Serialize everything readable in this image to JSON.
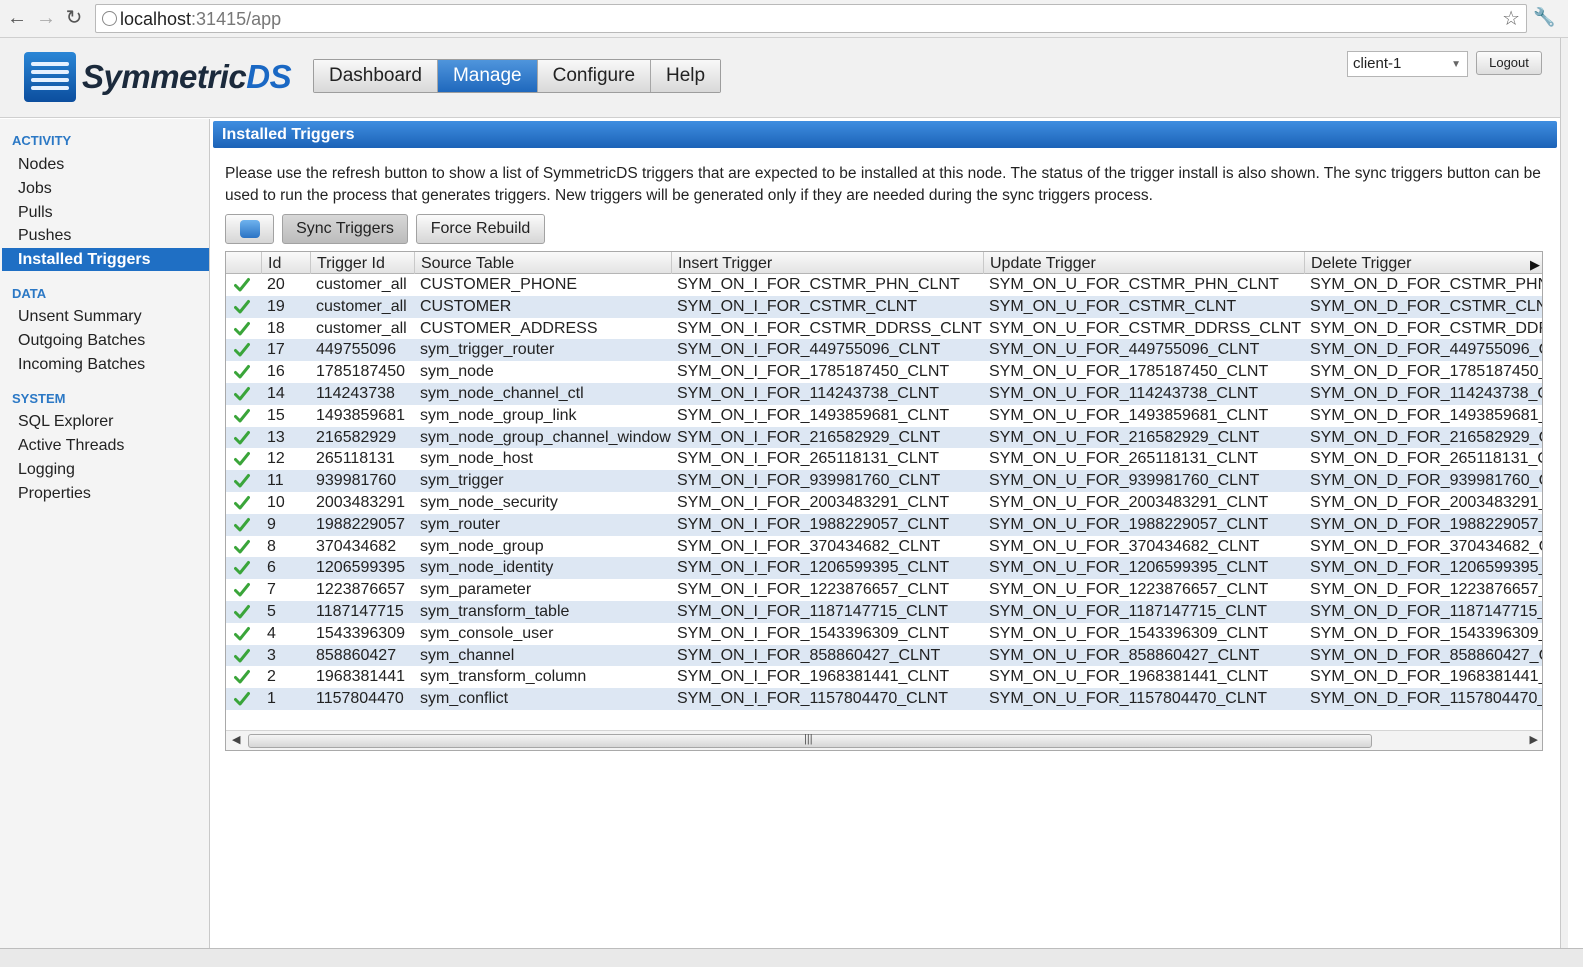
{
  "browser": {
    "url_host": "localhost",
    "url_rest": ":31415/app"
  },
  "app": {
    "logo_main": "Symmetric",
    "logo_accent": "DS",
    "tabs": [
      "Dashboard",
      "Manage",
      "Configure",
      "Help"
    ],
    "active_tab": "Manage",
    "node_select": "client-1",
    "logout_label": "Logout"
  },
  "sidebar": {
    "sections": [
      {
        "title": "ACTIVITY",
        "items": [
          "Nodes",
          "Jobs",
          "Pulls",
          "Pushes",
          "Installed Triggers"
        ]
      },
      {
        "title": "DATA",
        "items": [
          "Unsent Summary",
          "Outgoing Batches",
          "Incoming Batches"
        ]
      },
      {
        "title": "SYSTEM",
        "items": [
          "SQL Explorer",
          "Active Threads",
          "Logging",
          "Properties"
        ]
      }
    ],
    "active_item": "Installed Triggers"
  },
  "panel": {
    "title": "Installed Triggers",
    "description": "Please use the refresh button to show a list of SymmetricDS triggers that are expected to be installed at this node. The status of the trigger install is also shown. The sync triggers button can be used to run the process that generates triggers. New triggers will be generated only if they are needed during the sync triggers process.",
    "buttons": {
      "sync": "Sync Triggers",
      "rebuild": "Force Rebuild"
    }
  },
  "grid": {
    "columns": [
      "",
      "Id",
      "Trigger Id",
      "Source Table",
      "Insert Trigger",
      "Update Trigger",
      "Delete Trigger"
    ],
    "rows": [
      [
        "20",
        "customer_all",
        "CUSTOMER_PHONE",
        "SYM_ON_I_FOR_CSTMR_PHN_CLNT",
        "SYM_ON_U_FOR_CSTMR_PHN_CLNT",
        "SYM_ON_D_FOR_CSTMR_PHN_"
      ],
      [
        "19",
        "customer_all",
        "CUSTOMER",
        "SYM_ON_I_FOR_CSTMR_CLNT",
        "SYM_ON_U_FOR_CSTMR_CLNT",
        "SYM_ON_D_FOR_CSTMR_CLNT"
      ],
      [
        "18",
        "customer_all",
        "CUSTOMER_ADDRESS",
        "SYM_ON_I_FOR_CSTMR_DDRSS_CLNT",
        "SYM_ON_U_FOR_CSTMR_DDRSS_CLNT",
        "SYM_ON_D_FOR_CSTMR_DDR"
      ],
      [
        "17",
        "449755096",
        "sym_trigger_router",
        "SYM_ON_I_FOR_449755096_CLNT",
        "SYM_ON_U_FOR_449755096_CLNT",
        "SYM_ON_D_FOR_449755096_C"
      ],
      [
        "16",
        "1785187450",
        "sym_node",
        "SYM_ON_I_FOR_1785187450_CLNT",
        "SYM_ON_U_FOR_1785187450_CLNT",
        "SYM_ON_D_FOR_1785187450_"
      ],
      [
        "14",
        "114243738",
        "sym_node_channel_ctl",
        "SYM_ON_I_FOR_114243738_CLNT",
        "SYM_ON_U_FOR_114243738_CLNT",
        "SYM_ON_D_FOR_114243738_C"
      ],
      [
        "15",
        "1493859681",
        "sym_node_group_link",
        "SYM_ON_I_FOR_1493859681_CLNT",
        "SYM_ON_U_FOR_1493859681_CLNT",
        "SYM_ON_D_FOR_1493859681_"
      ],
      [
        "13",
        "216582929",
        "sym_node_group_channel_window",
        "SYM_ON_I_FOR_216582929_CLNT",
        "SYM_ON_U_FOR_216582929_CLNT",
        "SYM_ON_D_FOR_216582929_C"
      ],
      [
        "12",
        "265118131",
        "sym_node_host",
        "SYM_ON_I_FOR_265118131_CLNT",
        "SYM_ON_U_FOR_265118131_CLNT",
        "SYM_ON_D_FOR_265118131_C"
      ],
      [
        "11",
        "939981760",
        "sym_trigger",
        "SYM_ON_I_FOR_939981760_CLNT",
        "SYM_ON_U_FOR_939981760_CLNT",
        "SYM_ON_D_FOR_939981760_C"
      ],
      [
        "10",
        "2003483291",
        "sym_node_security",
        "SYM_ON_I_FOR_2003483291_CLNT",
        "SYM_ON_U_FOR_2003483291_CLNT",
        "SYM_ON_D_FOR_2003483291_"
      ],
      [
        "9",
        "1988229057",
        "sym_router",
        "SYM_ON_I_FOR_1988229057_CLNT",
        "SYM_ON_U_FOR_1988229057_CLNT",
        "SYM_ON_D_FOR_1988229057_"
      ],
      [
        "8",
        "370434682",
        "sym_node_group",
        "SYM_ON_I_FOR_370434682_CLNT",
        "SYM_ON_U_FOR_370434682_CLNT",
        "SYM_ON_D_FOR_370434682_C"
      ],
      [
        "6",
        "1206599395",
        "sym_node_identity",
        "SYM_ON_I_FOR_1206599395_CLNT",
        "SYM_ON_U_FOR_1206599395_CLNT",
        "SYM_ON_D_FOR_1206599395_"
      ],
      [
        "7",
        "1223876657",
        "sym_parameter",
        "SYM_ON_I_FOR_1223876657_CLNT",
        "SYM_ON_U_FOR_1223876657_CLNT",
        "SYM_ON_D_FOR_1223876657_"
      ],
      [
        "5",
        "1187147715",
        "sym_transform_table",
        "SYM_ON_I_FOR_1187147715_CLNT",
        "SYM_ON_U_FOR_1187147715_CLNT",
        "SYM_ON_D_FOR_1187147715_"
      ],
      [
        "4",
        "1543396309",
        "sym_console_user",
        "SYM_ON_I_FOR_1543396309_CLNT",
        "SYM_ON_U_FOR_1543396309_CLNT",
        "SYM_ON_D_FOR_1543396309_"
      ],
      [
        "3",
        "858860427",
        "sym_channel",
        "SYM_ON_I_FOR_858860427_CLNT",
        "SYM_ON_U_FOR_858860427_CLNT",
        "SYM_ON_D_FOR_858860427_C"
      ],
      [
        "2",
        "1968381441",
        "sym_transform_column",
        "SYM_ON_I_FOR_1968381441_CLNT",
        "SYM_ON_U_FOR_1968381441_CLNT",
        "SYM_ON_D_FOR_1968381441_"
      ],
      [
        "1",
        "1157804470",
        "sym_conflict",
        "SYM_ON_I_FOR_1157804470_CLNT",
        "SYM_ON_U_FOR_1157804470_CLNT",
        "SYM_ON_D_FOR_1157804470_"
      ]
    ]
  },
  "icons": {
    "status_icon": "check-icon",
    "refresh_icon": "refresh-icon"
  },
  "colors": {
    "accent": "#1f6fc4",
    "status_ok": "#3aa53a",
    "row_alt": "#dde7f3"
  }
}
